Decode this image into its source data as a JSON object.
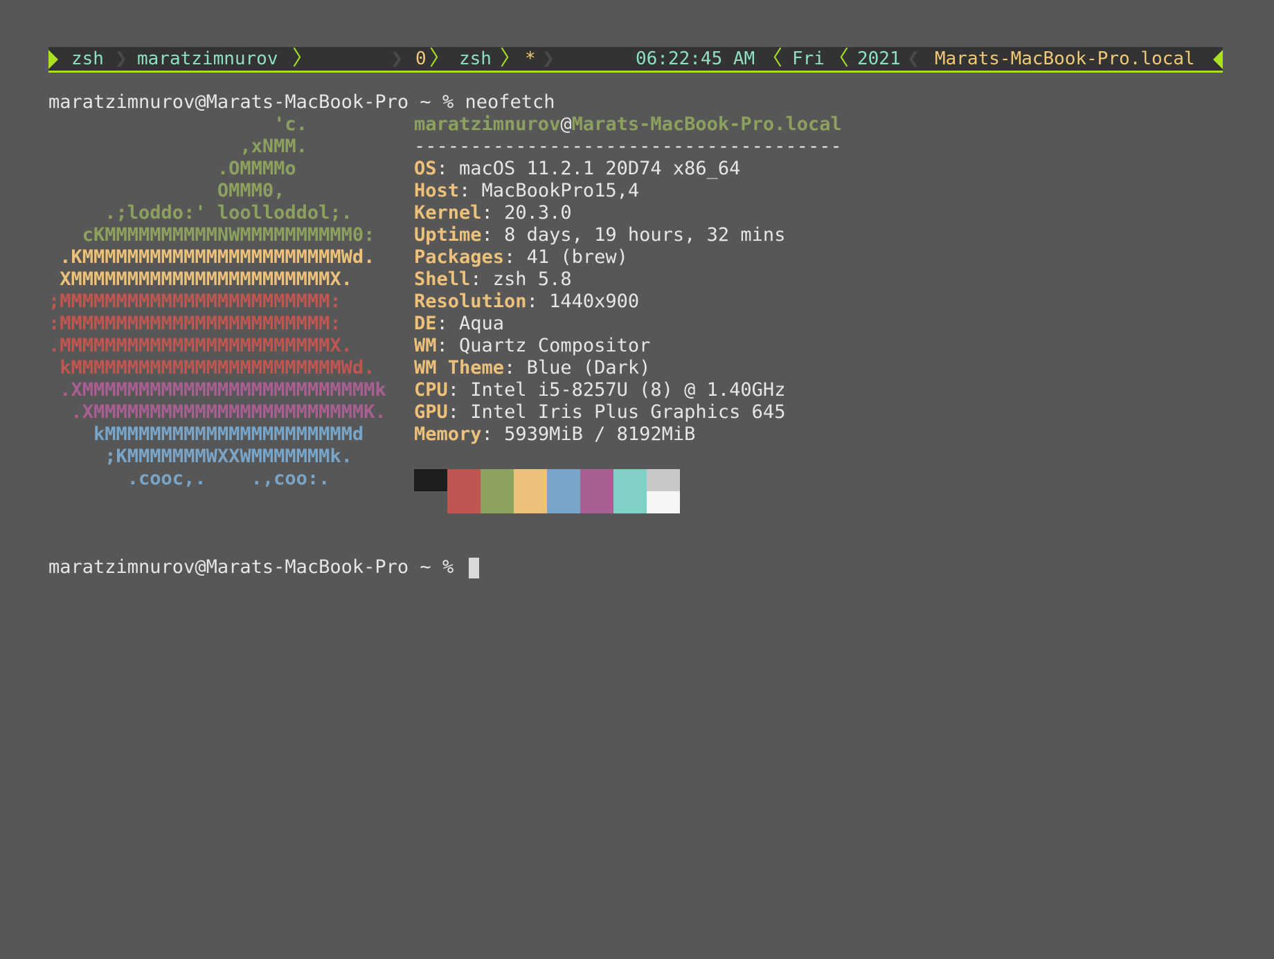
{
  "statusbar": {
    "session": "zsh",
    "user": "maratzimnurov",
    "window_index": "0",
    "window_name": "zsh",
    "window_flag": "*",
    "time": "06:22:45 AM",
    "day": "Fri",
    "year": "2021",
    "hostname": "Marats-MacBook-Pro.local"
  },
  "terminal": {
    "prompt": "maratzimnurov@Marats-MacBook-Pro ~ % ",
    "command": "neofetch",
    "prompt2": "maratzimnurov@Marats-MacBook-Pro ~ % "
  },
  "ascii_art": [
    {
      "text": "                    'c.",
      "color": "green"
    },
    {
      "text": "                 ,xNMM.",
      "color": "green"
    },
    {
      "text": "               .OMMMMo",
      "color": "green"
    },
    {
      "text": "               OMMM0,",
      "color": "green"
    },
    {
      "text": "     .;loddo:' loolloddol;.",
      "color": "green"
    },
    {
      "text": "   cKMMMMMMMMMMNWMMMMMMMMMM0:",
      "color": "green"
    },
    {
      "text": " .KMMMMMMMMMMMMMMMMMMMMMMMWd.",
      "color": "yellow"
    },
    {
      "text": " XMMMMMMMMMMMMMMMMMMMMMMMX.",
      "color": "yellow"
    },
    {
      "text": ";MMMMMMMMMMMMMMMMMMMMMMMM:",
      "color": "red"
    },
    {
      "text": ":MMMMMMMMMMMMMMMMMMMMMMMM:",
      "color": "red"
    },
    {
      "text": ".MMMMMMMMMMMMMMMMMMMMMMMMX.",
      "color": "red"
    },
    {
      "text": " kMMMMMMMMMMMMMMMMMMMMMMMMWd.",
      "color": "red"
    },
    {
      "text": " .XMMMMMMMMMMMMMMMMMMMMMMMMMMk",
      "color": "purple"
    },
    {
      "text": "  .XMMMMMMMMMMMMMMMMMMMMMMMMK.",
      "color": "purple"
    },
    {
      "text": "    kMMMMMMMMMMMMMMMMMMMMMMd",
      "color": "blue"
    },
    {
      "text": "     ;KMMMMMMMWXXWMMMMMMMk.",
      "color": "blue"
    },
    {
      "text": "       .cooc,.    .,coo:.",
      "color": "blue"
    }
  ],
  "info": {
    "user": "maratzimnurov",
    "at": "@",
    "host": "Marats-MacBook-Pro.local",
    "divider": "--------------------------------------",
    "items": [
      {
        "key": "OS",
        "value": "macOS 11.2.1 20D74 x86_64"
      },
      {
        "key": "Host",
        "value": "MacBookPro15,4"
      },
      {
        "key": "Kernel",
        "value": "20.3.0"
      },
      {
        "key": "Uptime",
        "value": "8 days, 19 hours, 32 mins"
      },
      {
        "key": "Packages",
        "value": "41 (brew)"
      },
      {
        "key": "Shell",
        "value": "zsh 5.8"
      },
      {
        "key": "Resolution",
        "value": "1440x900"
      },
      {
        "key": "DE",
        "value": "Aqua"
      },
      {
        "key": "WM",
        "value": "Quartz Compositor"
      },
      {
        "key": "WM Theme",
        "value": "Blue (Dark)"
      },
      {
        "key": "CPU",
        "value": "Intel i5-8257U (8) @ 1.40GHz"
      },
      {
        "key": "GPU",
        "value": "Intel Iris Plus Graphics 645"
      },
      {
        "key": "Memory",
        "value": "5939MiB / 8192MiB"
      }
    ],
    "separator": ": "
  },
  "palette": {
    "top": [
      "#1e1e1e",
      "#bf5651",
      "#8da15f",
      "#ecc17b",
      "#78a5c8",
      "#a85f91",
      "#80d0c6",
      "#c8c8c8"
    ],
    "bottom": [
      "#575757",
      "#bf5651",
      "#8da15f",
      "#ecc17b",
      "#78a5c8",
      "#a85f91",
      "#80d0c6",
      "#f5f5f5"
    ]
  }
}
